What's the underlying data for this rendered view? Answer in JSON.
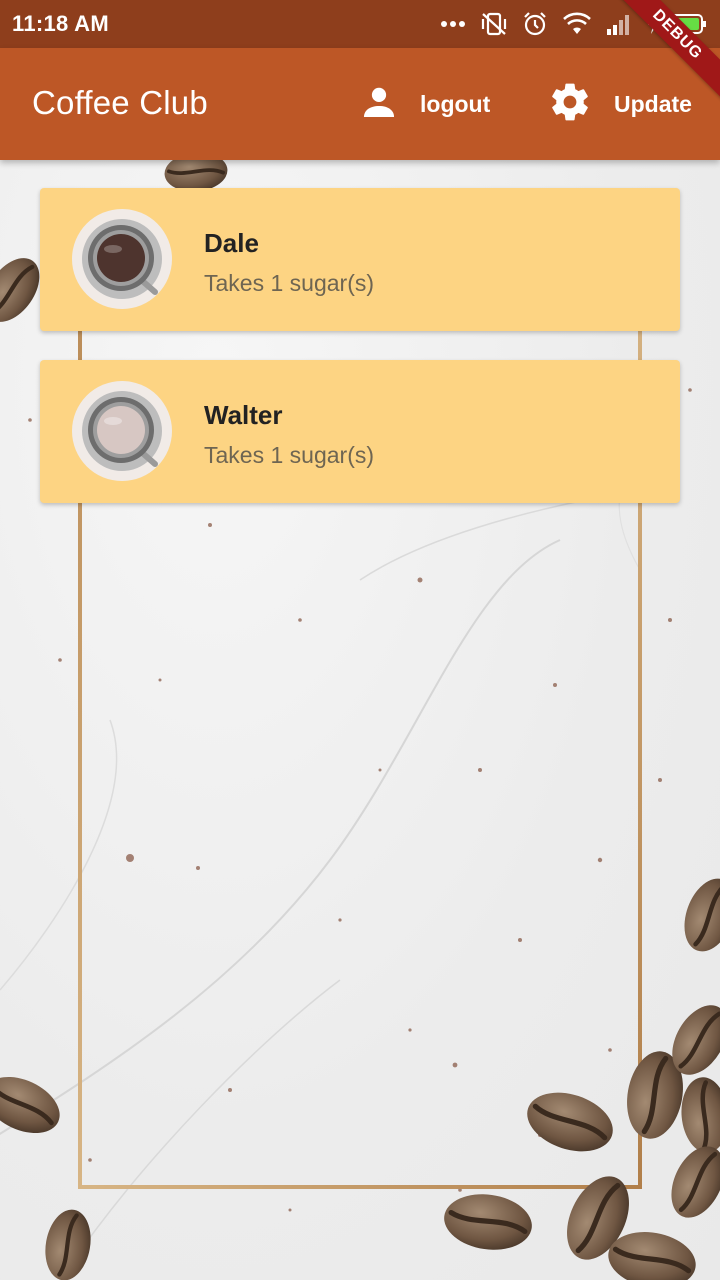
{
  "status_bar": {
    "time": "11:18 AM",
    "icons": [
      "more-dots-icon",
      "vibrate-off-icon",
      "alarm-icon",
      "wifi-icon",
      "signal-icon",
      "battery-charging-icon"
    ]
  },
  "debug_banner": "DEBUG",
  "app_bar": {
    "title": "Coffee Club",
    "actions": [
      {
        "icon": "person-icon",
        "label": "logout"
      },
      {
        "icon": "gear-icon",
        "label": "Update"
      }
    ]
  },
  "colors": {
    "status_bar": "#8e3e1c",
    "app_bar": "#bd5726",
    "card": "#fdd483",
    "frame": "#c39a66"
  },
  "members": [
    {
      "name": "Dale",
      "subtitle": "Takes 1 sugar(s)",
      "coffee_color": "#4e342e"
    },
    {
      "name": "Walter",
      "subtitle": "Takes 1 sugar(s)",
      "coffee_color": "#d7c7c3"
    }
  ]
}
